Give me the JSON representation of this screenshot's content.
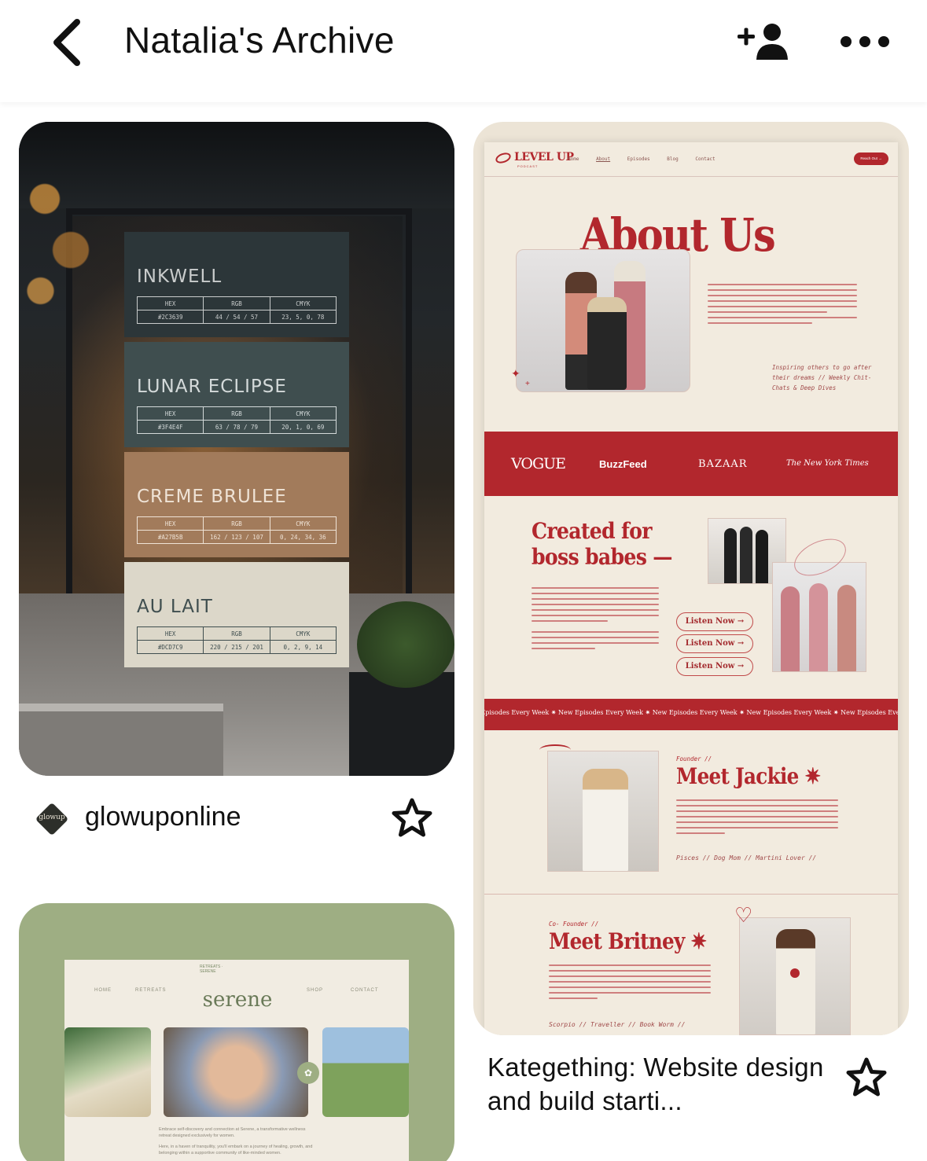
{
  "header": {
    "title": "Natalia's Archive",
    "back_icon": "chevron-left-icon",
    "add_user_icon": "add-person-icon",
    "more_icon": "more-horizontal-icon"
  },
  "pins": [
    {
      "swatches": [
        {
          "name": "INKWELL",
          "hex": "#2C3639",
          "rgb": "44 / 54 / 57",
          "cmyk": "23, 5, 0, 78",
          "bg": "#2C3639",
          "fg": "#c9cccc"
        },
        {
          "name": "LUNAR ECLIPSE",
          "hex": "#3F4E4F",
          "rgb": "63 / 78 / 79",
          "cmyk": "20, 1, 0, 69",
          "bg": "#3F4E4F",
          "fg": "#d4dada"
        },
        {
          "name": "CREME BRULEE",
          "hex": "#A27B5B",
          "rgb": "162 / 123 / 107",
          "cmyk": "0, 24, 34, 36",
          "bg": "#A27B5B",
          "fg": "#efe3d6"
        },
        {
          "name": "AU LAIT",
          "hex": "#DCD7C9",
          "rgb": "220 / 215 / 201",
          "cmyk": "0, 2, 9, 14",
          "bg": "#DCD7C9",
          "fg": "#3f4e4f"
        }
      ],
      "col_labels": {
        "hex": "HEX",
        "rgb": "RGB",
        "cmyk": "CMYK"
      },
      "source": {
        "avatar_text": "glowup",
        "username": "glowuponline"
      }
    },
    {
      "site": {
        "logo": "LEVEL UP",
        "logo_sub": "PODCAST",
        "nav": [
          "Home",
          "About",
          "Episodes",
          "Blog",
          "Contact"
        ],
        "cta": "Reach Out →",
        "about_title": "About Us",
        "note": "Inspiring others to go after their dreams // Weekly Chit-Chats & Deep Dives",
        "press": [
          "VOGUE",
          "BuzzFeed",
          "BAZAAR",
          "The New York Times"
        ],
        "created_title_1": "Created for",
        "created_title_2": "boss babes —",
        "listen": [
          "Listen Now →",
          "Listen Now →",
          "Listen Now →"
        ],
        "ticker": "w Episodes Every Week ✷ New Episodes Every Week ✷ New Episodes Every Week ✷ New Episodes Every Week ✷ New Episodes Every Week ✷ New Episod",
        "founder_label": "Founder //",
        "founder_name": "Meet Jackie ✷",
        "founder_tags": "Pisces // Dog Mom // Martini Lover //",
        "cofounder_label": "Co- Founder //",
        "cofounder_name": "Meet Britney ✷",
        "cofounder_tags": "Scorpio // Traveller // Book Worm //"
      },
      "caption": "Kategething: Website design and build starti..."
    },
    {
      "site": {
        "nav_left": [
          "HOME",
          "RETREATS"
        ],
        "nav_right": [
          "SHOP",
          "CONTACT"
        ],
        "logo": "serene",
        "ring_text": "RETREATS · SERENE",
        "copy_1": "Embrace self-discovery and connection at Serene, a transformative wellness retreat designed exclusively for women.",
        "copy_2": "Here, in a haven of tranquility, you'll embark on a journey of healing, growth, and belonging within a supportive community of like-minded women."
      }
    }
  ],
  "star_icon": "star-outline-icon"
}
